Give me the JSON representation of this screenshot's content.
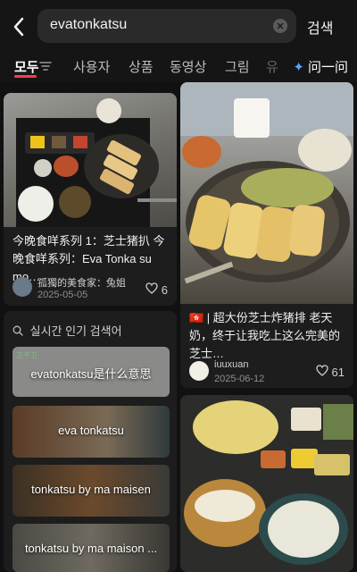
{
  "header": {
    "search_value": "evatonkatsu",
    "search_button": "검색"
  },
  "tabs": {
    "items": [
      "모두",
      "사용자",
      "상품",
      "동영상",
      "그림"
    ],
    "faded": "유",
    "ai_label": "问一问"
  },
  "cards": [
    {
      "title": "今晚食咩系列 1：芝士猪扒 今晚食咩系列：Eva Tonka su mo…",
      "author": "孤獨的美食家：兔姐",
      "date": "2025-05-05",
      "likes": "6"
    },
    {
      "title": "🇭🇰 | 超大份芝士炸猪排 老天奶，终于让我吃上这么完美的芝士…",
      "author": "iuuxuan",
      "date": "2025-06-12",
      "likes": "61"
    }
  ],
  "trending": {
    "heading": "실시간 인기 검색어",
    "items": [
      {
        "label": "evatonkatsu是什么意思",
        "tag": "卫不卫"
      },
      {
        "label": "eva tonkatsu"
      },
      {
        "label": "tonkatsu by ma maisen"
      },
      {
        "label": "tonkatsu by ma maison ..."
      }
    ]
  },
  "icons": {
    "back": "back-arrow-icon",
    "clear": "clear-icon",
    "filter": "filter-icon",
    "ai": "sparkle-icon",
    "heart": "heart-icon",
    "search": "search-icon"
  }
}
